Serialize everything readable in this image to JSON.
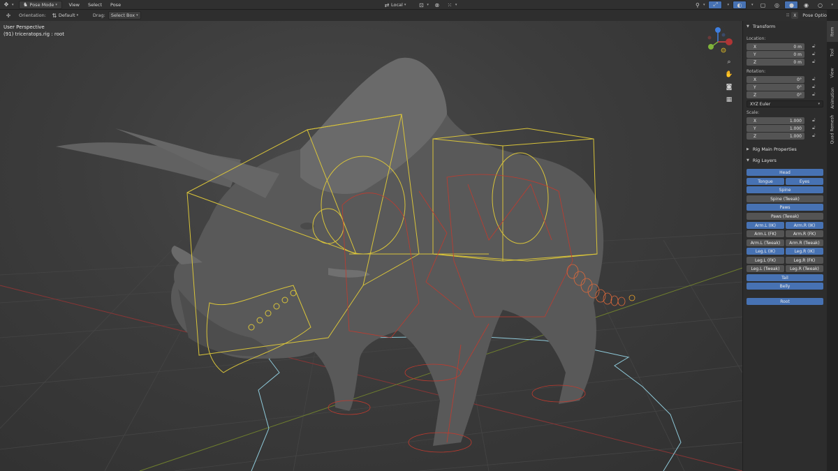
{
  "header": {
    "mode": "Pose Mode",
    "menus": [
      "View",
      "Select",
      "Pose"
    ],
    "transform_orientation": "Local"
  },
  "toolbar": {
    "orientation_label": "Orientation:",
    "orientation_value": "Default",
    "drag_label": "Drag:",
    "drag_value": "Select Box",
    "pose_options": "Pose Options"
  },
  "viewport": {
    "view_name": "User Perspective",
    "object_info": "(91) triceratops.rig : root"
  },
  "gizmo": {
    "x": "X",
    "y": "Y",
    "z": "Z"
  },
  "tabs": [
    "Item",
    "Tool",
    "View",
    "Animation",
    "Quad Remesh"
  ],
  "transform": {
    "title": "Transform",
    "location_label": "Location:",
    "location": [
      {
        "axis": "X",
        "value": "0 m"
      },
      {
        "axis": "Y",
        "value": "0 m"
      },
      {
        "axis": "Z",
        "value": "0 m"
      }
    ],
    "rotation_label": "Rotation:",
    "rotation": [
      {
        "axis": "X",
        "value": "0°"
      },
      {
        "axis": "Y",
        "value": "0°"
      },
      {
        "axis": "Z",
        "value": "0°"
      }
    ],
    "rotation_mode": "XYZ Euler",
    "scale_label": "Scale:",
    "scale": [
      {
        "axis": "X",
        "value": "1.000"
      },
      {
        "axis": "Y",
        "value": "1.000"
      },
      {
        "axis": "Z",
        "value": "1.000"
      }
    ]
  },
  "panels": {
    "rig_main": "Rig Main Properties",
    "rig_layers": "Rig Layers"
  },
  "rig_layers": {
    "head": "Head",
    "tongue": "Tongue",
    "eyes": "Eyes",
    "spine": "Spine",
    "spine_tweak": "Spine (Tweak)",
    "paws": "Paws",
    "paws_tweak": "Paws (Tweak)",
    "arm_l_ik": "Arm.L (IK)",
    "arm_r_ik": "Arm.R (IK)",
    "arm_l_fk": "Arm.L (FK)",
    "arm_r_fk": "Arm.R (FK)",
    "arm_l_tweak": "Arm.L (Tweak)",
    "arm_r_tweak": "Arm.R (Tweak)",
    "leg_l_ik": "Leg.L (IK)",
    "leg_r_ik": "Leg.R (IK)",
    "leg_l_fk": "Leg.L (FK)",
    "leg_r_fk": "Leg.R (FK)",
    "leg_l_tweak": "Leg.L (Tweak)",
    "leg_r_tweak": "Leg.R (Tweak)",
    "tail": "Tail",
    "belly": "Belly",
    "root": "Root"
  },
  "colors": {
    "accent": "#4772b3",
    "rig_yellow": "#d9c43a",
    "rig_red": "#c23a2e",
    "floor_cyan": "#8ec9d9",
    "axis_x": "#d24545",
    "axis_y": "#7fb33a",
    "axis_z": "#3f7fe0"
  }
}
